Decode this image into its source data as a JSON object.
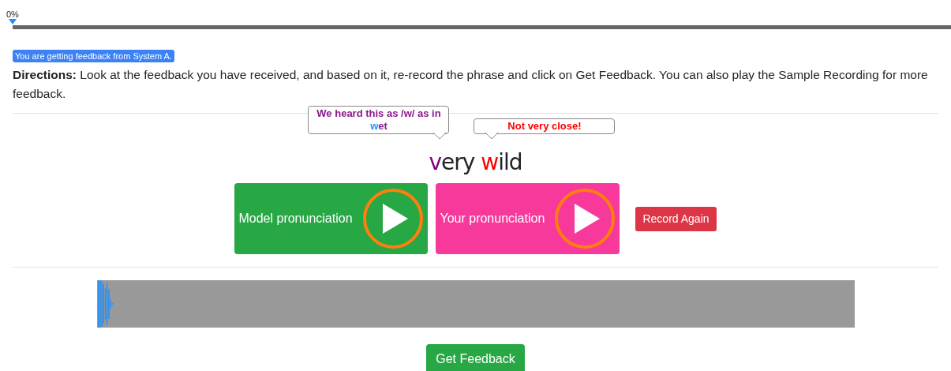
{
  "progress": {
    "label": "0%",
    "level": 0
  },
  "badge": "You are getting feedback from System A.",
  "directions": {
    "label": "Directions:",
    "text": "Look at the feedback you have received, and based on it, re-record the phrase and click on Get Feedback. You can also play the Sample Recording for more feedback."
  },
  "phrase": [
    {
      "segments": [
        {
          "text": "v",
          "color": "#800080"
        },
        {
          "text": "ery",
          "color": "#212529"
        }
      ]
    },
    {
      "segments": [
        {
          "text": "w",
          "color": "#ff0000"
        },
        {
          "text": "ild",
          "color": "#212529"
        }
      ]
    }
  ],
  "tooltips": [
    {
      "segments": [
        {
          "text": "We heard this as /w/ as in ",
          "color": "#8b1a8b"
        },
        {
          "text": "w",
          "color": "#1e90ff"
        },
        {
          "text": "et",
          "color": "#8b1a8b"
        }
      ]
    },
    {
      "segments": [
        {
          "text": "Not very close!",
          "color": "#ff0000"
        }
      ]
    }
  ],
  "players": [
    {
      "label": "Model pronunciation",
      "color": "#28a745"
    },
    {
      "label": "Your pronunciation",
      "color": "#f7399b"
    }
  ],
  "record_button": "Record Again",
  "submit_button": "Get Feedback"
}
